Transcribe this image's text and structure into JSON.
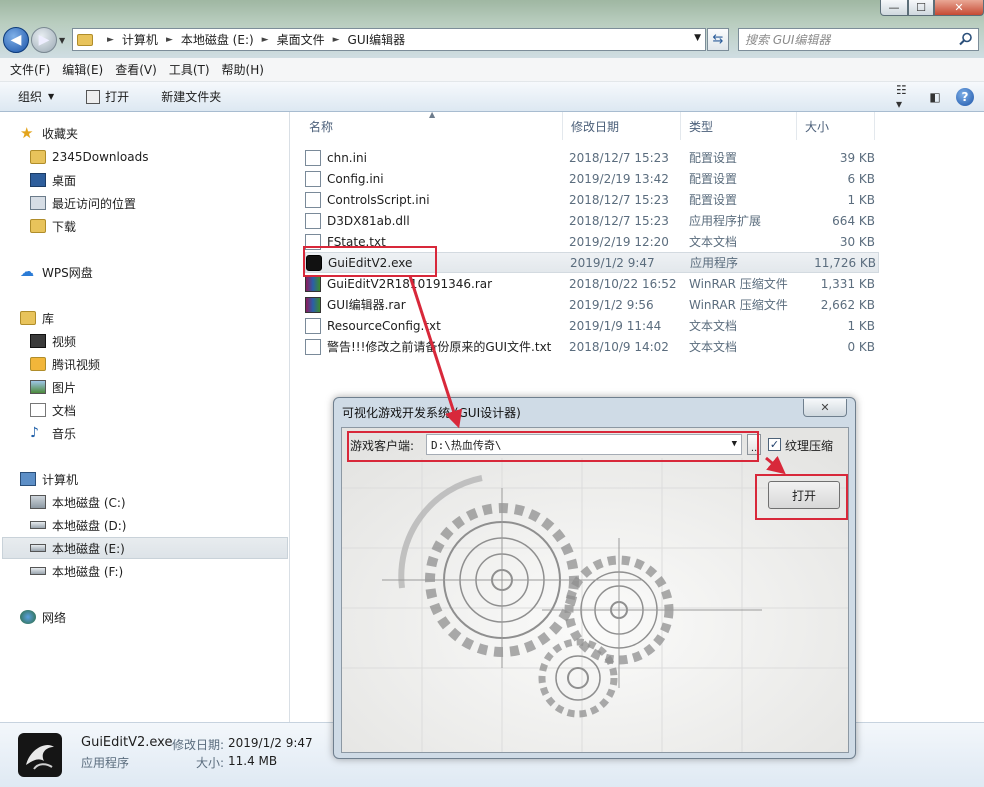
{
  "window": {
    "minimize_glyph": "—",
    "maximize_glyph": "☐",
    "close_glyph": "✕"
  },
  "address": {
    "crumbs": [
      "计算机",
      "本地磁盘 (E:)",
      "桌面文件",
      "GUI编辑器"
    ],
    "search_placeholder": "搜索 GUI编辑器"
  },
  "menu": [
    "文件(F)",
    "编辑(E)",
    "查看(V)",
    "工具(T)",
    "帮助(H)"
  ],
  "toolbar": {
    "organize": "组织",
    "open": "打开",
    "new_folder": "新建文件夹"
  },
  "sidebar": {
    "favorites": "收藏夹",
    "fav_items": [
      "2345Downloads",
      "桌面",
      "最近访问的位置",
      "下载"
    ],
    "wps": "WPS网盘",
    "library": "库",
    "lib_items": [
      "视频",
      "腾讯视频",
      "图片",
      "文档",
      "音乐"
    ],
    "computer": "计算机",
    "drives": [
      "本地磁盘 (C:)",
      "本地磁盘 (D:)",
      "本地磁盘 (E:)",
      "本地磁盘 (F:)"
    ],
    "network": "网络"
  },
  "columns": {
    "name": "名称",
    "date": "修改日期",
    "type": "类型",
    "size": "大小"
  },
  "files": [
    {
      "name": "chn.ini",
      "date": "2018/12/7 15:23",
      "type": "配置设置",
      "size": "39 KB"
    },
    {
      "name": "Config.ini",
      "date": "2019/2/19 13:42",
      "type": "配置设置",
      "size": "6 KB"
    },
    {
      "name": "ControlsScript.ini",
      "date": "2018/12/7 15:23",
      "type": "配置设置",
      "size": "1 KB"
    },
    {
      "name": "D3DX81ab.dll",
      "date": "2018/12/7 15:23",
      "type": "应用程序扩展",
      "size": "664 KB"
    },
    {
      "name": "FState.txt",
      "date": "2019/2/19 12:20",
      "type": "文本文档",
      "size": "30 KB"
    },
    {
      "name": "GuiEditV2.exe",
      "date": "2019/1/2 9:47",
      "type": "应用程序",
      "size": "11,726 KB"
    },
    {
      "name": "GuiEditV2R1810191346.rar",
      "date": "2018/10/22 16:52",
      "type": "WinRAR 压缩文件",
      "size": "1,331 KB"
    },
    {
      "name": "GUI编辑器.rar",
      "date": "2019/1/2 9:56",
      "type": "WinRAR 压缩文件",
      "size": "2,662 KB"
    },
    {
      "name": "ResourceConfig.txt",
      "date": "2019/1/9 11:44",
      "type": "文本文档",
      "size": "1 KB"
    },
    {
      "name": "警告!!!修改之前请备份原来的GUI文件.txt",
      "date": "2018/10/9 14:02",
      "type": "文本文档",
      "size": "0 KB"
    }
  ],
  "details": {
    "name": "GuiEditV2.exe",
    "date_label": "修改日期:",
    "date": "2019/1/2 9:47",
    "type": "应用程序",
    "size_label": "大小:",
    "size": "11.4 MB"
  },
  "dialog": {
    "title": "可视化游戏开发系统 (GUI设计器)",
    "close_glyph": "✕",
    "client_label": "游戏客户端:",
    "client_value": "D:\\热血传奇\\",
    "browse": "..",
    "compress_label": "纹理压缩",
    "compress_checked": "✓",
    "open_button": "打开"
  },
  "colors": {
    "highlight": "#d8283a",
    "accent": "#1a53a8"
  }
}
